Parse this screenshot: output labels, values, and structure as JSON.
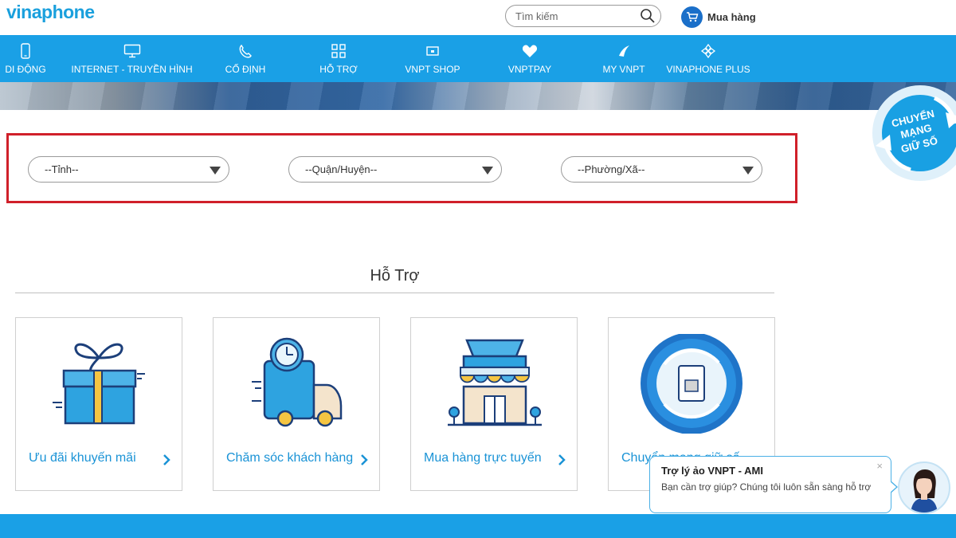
{
  "header": {
    "logo_text": "vinaphone",
    "search_placeholder": "Tìm kiếm",
    "cart_label": "Mua hàng"
  },
  "nav": {
    "items": [
      {
        "label": "DI ĐỘNG",
        "icon": "phone-icon"
      },
      {
        "label": "INTERNET - TRUYỀN HÌNH",
        "icon": "monitor-icon"
      },
      {
        "label": "CỐ ĐỊNH",
        "icon": "landline-icon"
      },
      {
        "label": "HỖ TRỢ",
        "icon": "grid-icon"
      },
      {
        "label": "VNPT SHOP",
        "icon": "shop-icon"
      },
      {
        "label": "VNPTPAY",
        "icon": "heart-icon"
      },
      {
        "label": "MY VNPT",
        "icon": "vnpt-logo-icon"
      },
      {
        "label": "VINAPHONE PLUS",
        "icon": "plus-network-icon"
      }
    ]
  },
  "badge": {
    "line1": "CHUYỂN",
    "line2": "MẠNG",
    "line3": "GIỮ SỐ"
  },
  "filters": {
    "province": "--Tỉnh--",
    "district": "--Quận/Huyện--",
    "ward": "--Phường/Xã--"
  },
  "section": {
    "title": "Hỗ Trợ",
    "cards": [
      {
        "label": "Ưu đãi khuyến mãi",
        "icon": "gift-icon"
      },
      {
        "label": "Chăm sóc khách hàng",
        "icon": "delivery-truck-icon"
      },
      {
        "label": "Mua hàng trực tuyến",
        "icon": "storefront-icon"
      },
      {
        "label": "Chuyển mạng giữ số",
        "icon": "sim-swap-icon"
      }
    ]
  },
  "chat": {
    "title": "Trợ lý ảo VNPT - AMI",
    "message": "Bạn cần trợ giúp? Chúng tôi luôn sẵn sàng hỗ trợ",
    "close": "×"
  },
  "colors": {
    "brand_blue": "#1aa0e6",
    "highlight_red": "#d0202a",
    "link_blue": "#1a93d6"
  }
}
